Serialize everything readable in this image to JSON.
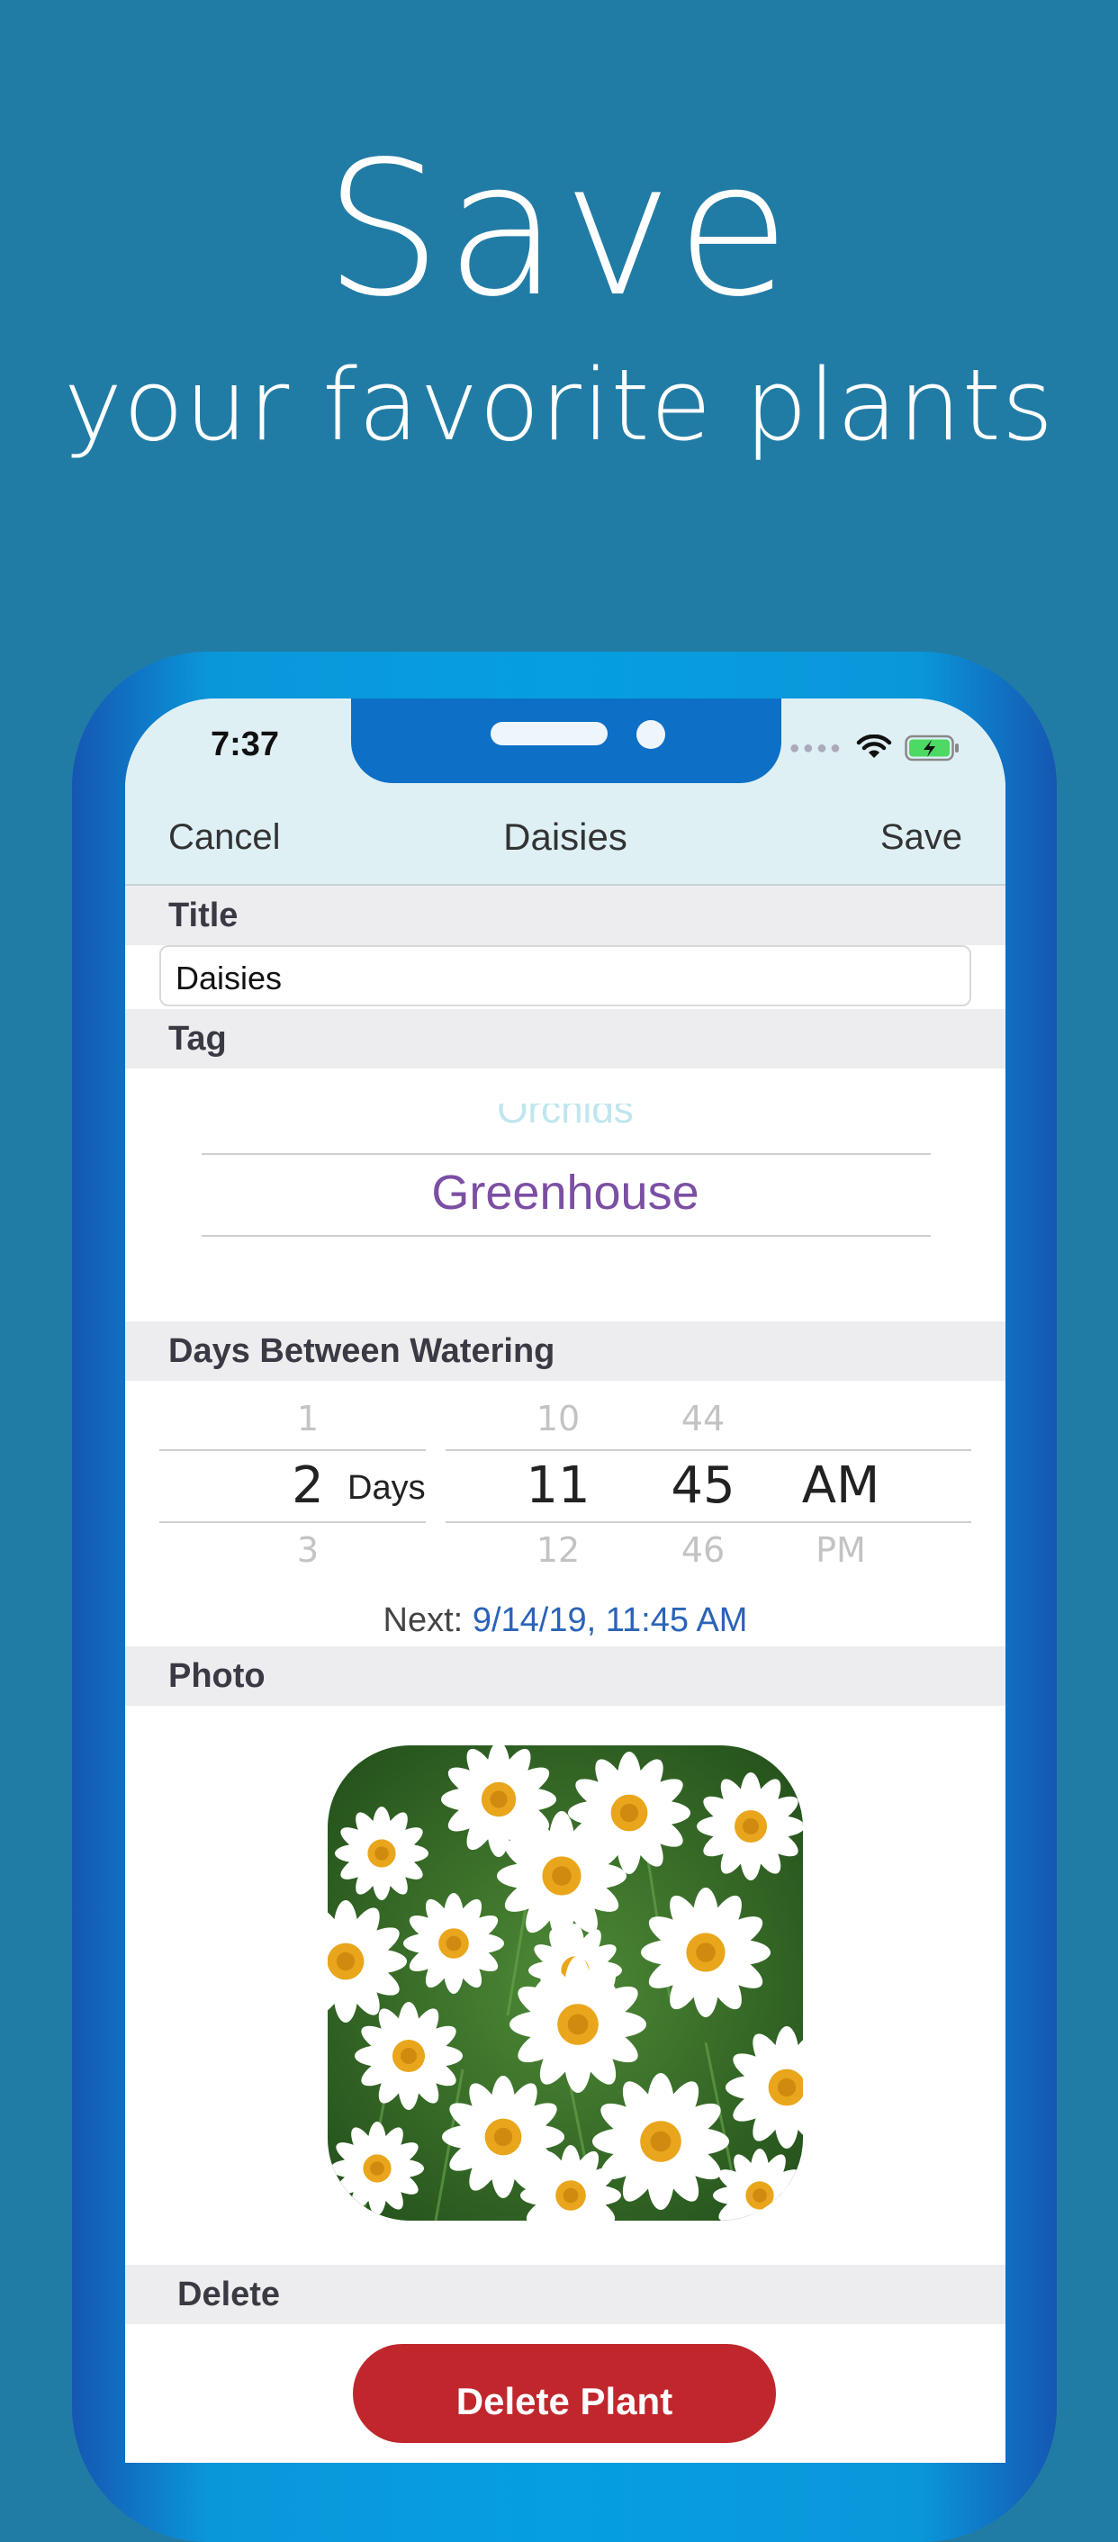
{
  "headline": {
    "line1": "Save",
    "line2": "your favorite plants"
  },
  "status_bar": {
    "time": "7:37"
  },
  "nav": {
    "cancel": "Cancel",
    "title": "Daisies",
    "save": "Save"
  },
  "sections": {
    "title": "Title",
    "tag": "Tag",
    "watering": "Days Between Watering",
    "photo": "Photo",
    "delete": "Delete"
  },
  "title_field": {
    "value": "Daisies"
  },
  "tag_picker": {
    "above": "Orchids",
    "selected": "Greenhouse"
  },
  "watering_picker": {
    "days": {
      "above": "1",
      "selected": "2",
      "below": "3",
      "unit": "Days"
    },
    "hour": {
      "above": "10",
      "selected": "11",
      "below": "12"
    },
    "minute": {
      "above": "44",
      "selected": "45",
      "below": "46"
    },
    "ampm": {
      "selected": "AM",
      "below": "PM"
    }
  },
  "next_watering": {
    "label": "Next:",
    "value": "9/14/19, 11:45 AM"
  },
  "delete_button": {
    "label": "Delete Plant"
  },
  "colors": {
    "background": "#217ca5",
    "nav_bar": "#dff0f5",
    "tag_selected": "#7b4fa3",
    "next_value": "#2a63b8",
    "delete_button": "#c0272d"
  },
  "icons": [
    "wifi-icon",
    "battery-charging-icon",
    "signal-dots-icon"
  ]
}
